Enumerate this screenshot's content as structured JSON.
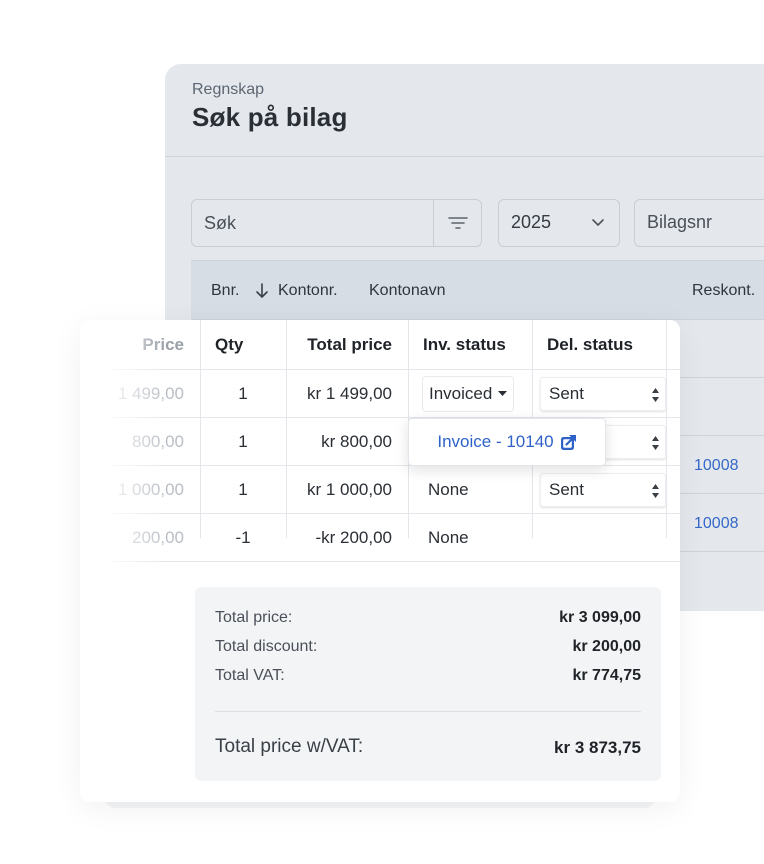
{
  "back": {
    "eyebrow": "Regnskap",
    "title": "Søk på bilag",
    "search_placeholder": "Søk",
    "year": "2025",
    "bilagsnr_placeholder": "Bilagsnr",
    "headers": {
      "bnr": "Bnr.",
      "kontonr": "Kontonr.",
      "kontonavn": "Kontonavn",
      "reskont": "Reskont."
    },
    "reskont_links": [
      "10008",
      "10008"
    ]
  },
  "table": {
    "headers": {
      "price": "Price",
      "qty": "Qty",
      "total": "Total price",
      "inv_status": "Inv. status",
      "del_status": "Del. status"
    },
    "rows": [
      {
        "price": "1 499,00",
        "qty": "1",
        "total": "kr 1 499,00",
        "inv_status": "Invoiced",
        "del_status": "Sent"
      },
      {
        "price": "800,00",
        "qty": "1",
        "total": "kr 800,00",
        "inv_status": "",
        "del_status": ""
      },
      {
        "price": "1 000,00",
        "qty": "1",
        "total": "kr 1 000,00",
        "inv_status": "None",
        "del_status": "Sent"
      },
      {
        "price": "200,00",
        "qty": "-1",
        "total": "-kr 200,00",
        "inv_status": "None",
        "del_status": ""
      }
    ]
  },
  "popover": {
    "label": "Invoice - 10140"
  },
  "summary": {
    "total_price_label": "Total price:",
    "total_price": "kr 3 099,00",
    "total_discount_label": "Total discount:",
    "total_discount": "kr 200,00",
    "total_vat_label": "Total VAT:",
    "total_vat": "kr 774,75",
    "grand_label": "Total price w/VAT:",
    "grand": "kr 3 873,75"
  },
  "colors": {
    "link": "#2f62c9",
    "back_bg": "#e4e8ed",
    "summary_bg": "#f3f4f6"
  }
}
